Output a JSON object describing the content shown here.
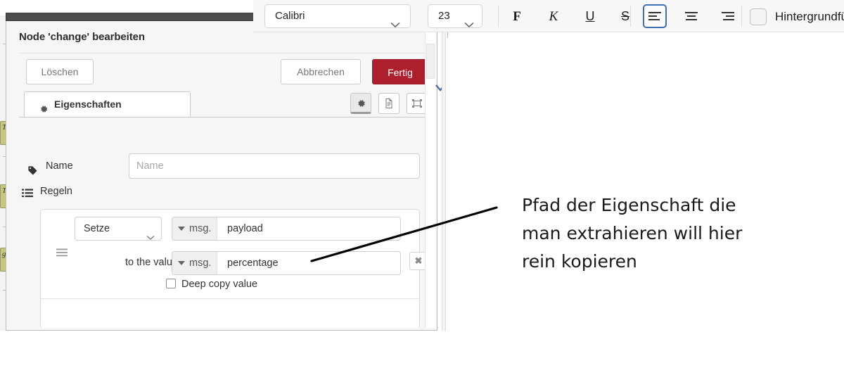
{
  "format_toolbar": {
    "font_family": "Calibri",
    "font_size": "23",
    "bold_label": "F",
    "italic_label": "K",
    "underline_label": "U",
    "strikethrough_label": "S",
    "align_left_name": "align-left",
    "align_center_name": "align-center",
    "align_right_name": "align-right",
    "align_selected": "align-left",
    "background_fill_label": "Hintergrundfü",
    "background_fill_checked": false,
    "selected_outline_color": "#3d6fb5"
  },
  "dialog": {
    "title": "Node 'change' bearbeiten",
    "buttons": {
      "delete": "Löschen",
      "cancel": "Abbrechen",
      "done": "Fertig",
      "done_color": "#ad1f2d"
    },
    "tabs": [
      {
        "label": "Eigenschaften",
        "icon": "gear-icon",
        "active": true
      }
    ],
    "icon_buttons": [
      {
        "name": "gear-icon",
        "active": true
      },
      {
        "name": "description-icon",
        "active": false
      },
      {
        "name": "appearance-icon",
        "active": false
      }
    ],
    "form": {
      "name_label": "Name",
      "name_placeholder": "Name",
      "name_value": "",
      "rules_label": "Regeln",
      "rule": {
        "action": "Setze",
        "property_prefix": "msg.",
        "property_value": "payload",
        "to_the_value_label": "to the value",
        "value_prefix": "msg.",
        "value_value": "percentage",
        "remove_label": "✖",
        "deep_copy_label": "Deep copy value",
        "deep_copy_checked": false
      }
    }
  },
  "flow_nodes": [
    {
      "label": "T"
    },
    {
      "label": "T"
    },
    {
      "label": "g."
    }
  ],
  "annotation": {
    "line1": "Pfad der Eigenschaft die",
    "line2": "man extrahieren will hier",
    "line3": "rein kopieren",
    "arrow_color": "#000000"
  }
}
